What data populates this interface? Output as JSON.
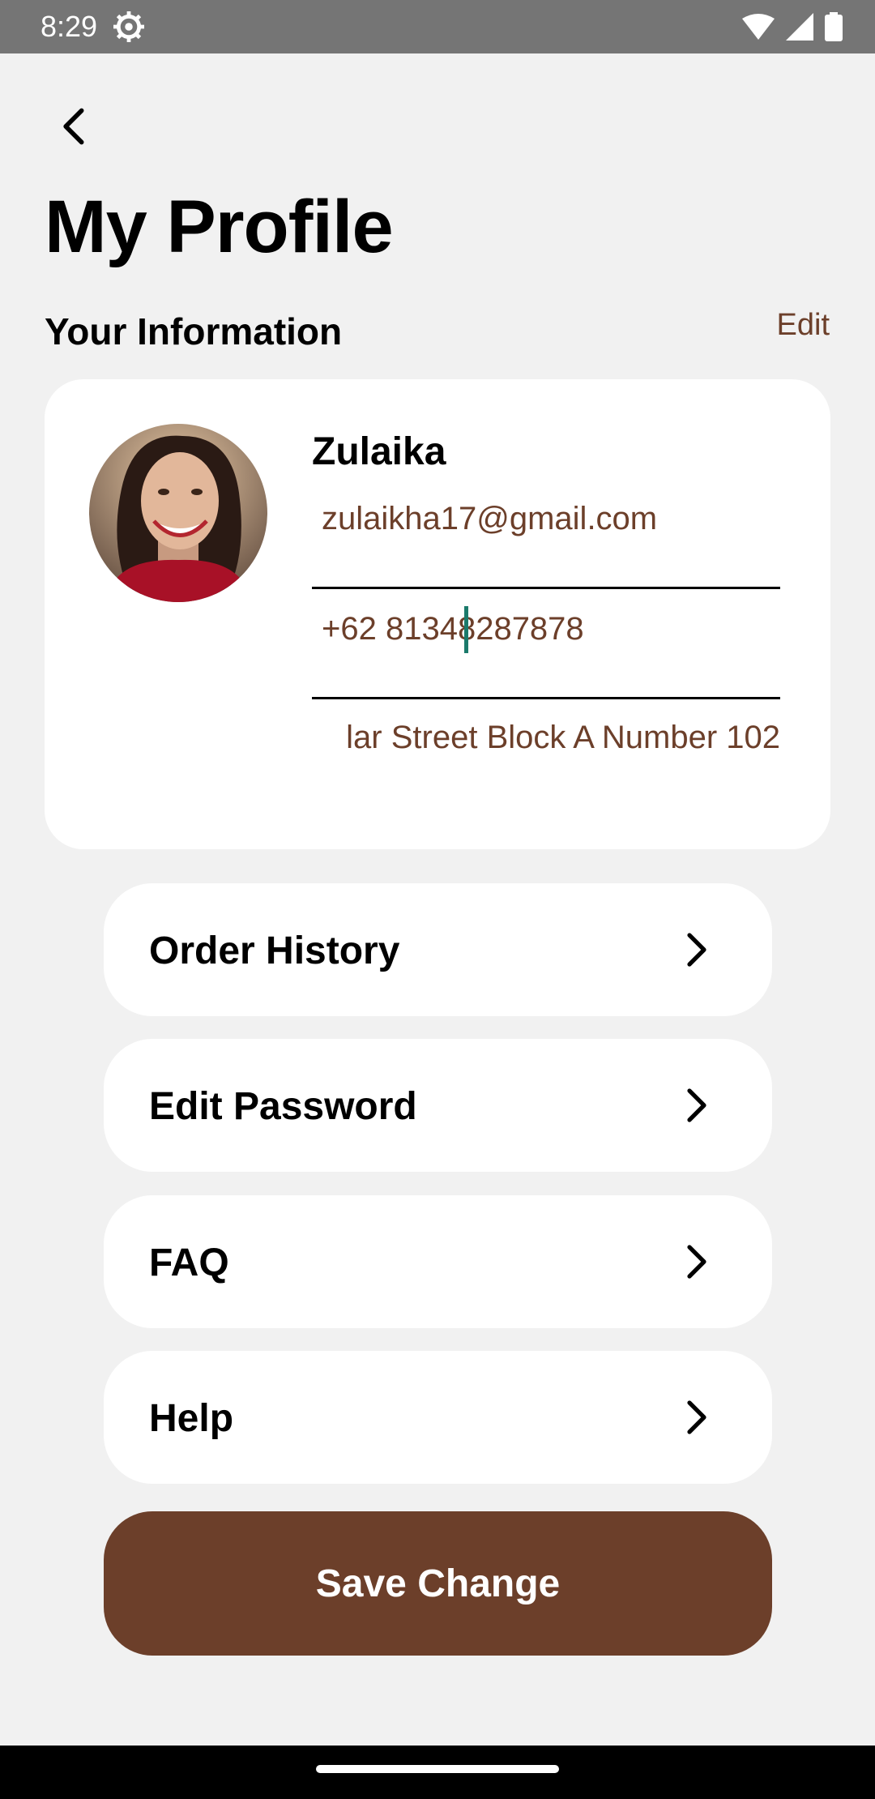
{
  "status_bar": {
    "time": "8:29"
  },
  "header": {
    "back_icon": "chevron-left-icon",
    "title": "My Profile"
  },
  "info": {
    "section_title": "Your Information",
    "edit_label": "Edit"
  },
  "profile": {
    "name": "Zulaika",
    "email": "zulaikha17@gmail.com",
    "phone": "+62 81348287878",
    "address": "lar Street Block A Number 102"
  },
  "menu": [
    {
      "label": "Order History",
      "icon": "chevron-right-icon"
    },
    {
      "label": "Edit Password",
      "icon": "chevron-right-icon"
    },
    {
      "label": "FAQ",
      "icon": "chevron-right-icon"
    },
    {
      "label": "Help",
      "icon": "chevron-right-icon"
    }
  ],
  "actions": {
    "save_label": "Save Change"
  },
  "colors": {
    "accent": "#6c3f2a",
    "background": "#f1f1f1",
    "cursor": "#1b7a6b"
  }
}
